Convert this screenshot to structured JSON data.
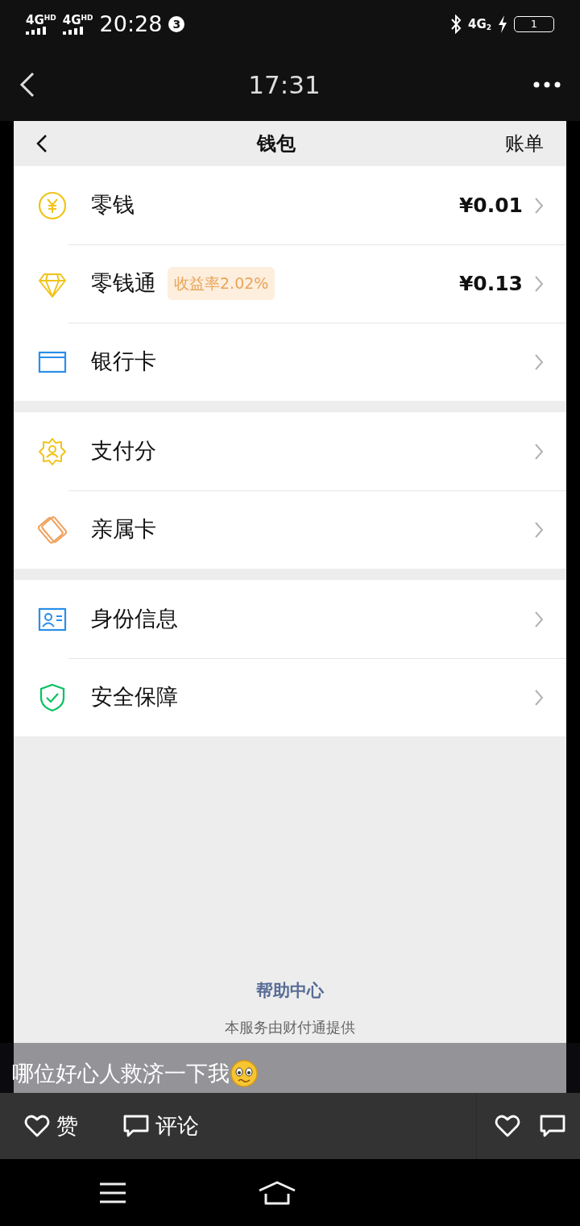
{
  "status_bar": {
    "sims": [
      {
        "network": "4G",
        "badge": "HD"
      },
      {
        "network": "4G",
        "badge": "HD"
      }
    ],
    "time": "20:28",
    "notification_count": "3",
    "data_network": "4G",
    "data_sim": "2",
    "battery": "1"
  },
  "viewer_header": {
    "title": "17:31"
  },
  "wallet": {
    "title": "钱包",
    "action": "账单",
    "sections": [
      [
        {
          "label": "零钱",
          "amount": "¥0.01"
        },
        {
          "label": "零钱通",
          "tag": "收益率2.02%",
          "amount": "¥0.13"
        },
        {
          "label": "银行卡"
        }
      ],
      [
        {
          "label": "支付分"
        },
        {
          "label": "亲属卡"
        }
      ],
      [
        {
          "label": "身份信息"
        },
        {
          "label": "安全保障"
        }
      ]
    ],
    "help_link": "帮助中心",
    "provider": "本服务由财付通提供"
  },
  "caption": "哪位好心人救济一下我",
  "actions": {
    "like": "赞",
    "comment": "评论"
  }
}
